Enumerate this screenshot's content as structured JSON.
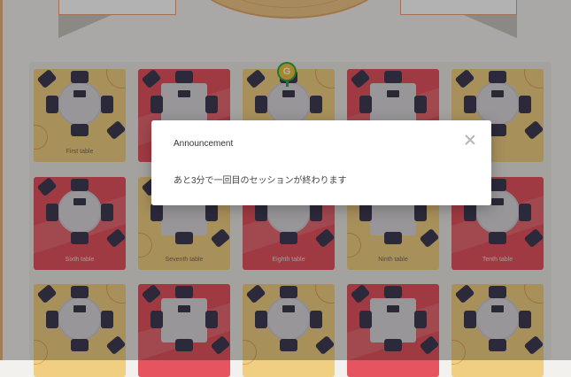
{
  "room": {
    "tables": [
      {
        "label": "First table",
        "style": "yellow",
        "desk": "round"
      },
      {
        "label": "",
        "style": "red",
        "desk": "square"
      },
      {
        "label": "",
        "style": "yellow",
        "desk": "round"
      },
      {
        "label": "",
        "style": "red",
        "desk": "square"
      },
      {
        "label": "",
        "style": "yellow",
        "desk": "round"
      },
      {
        "label": "Sixth table",
        "style": "red",
        "desk": "round"
      },
      {
        "label": "Seventh table",
        "style": "yellow",
        "desk": "square"
      },
      {
        "label": "Eighth table",
        "style": "red",
        "desk": "round"
      },
      {
        "label": "Ninth table",
        "style": "yellow",
        "desk": "square"
      },
      {
        "label": "Tenth table",
        "style": "red",
        "desk": "round"
      },
      {
        "label": "",
        "style": "yellow",
        "desk": "round"
      },
      {
        "label": "",
        "style": "red",
        "desk": "square"
      },
      {
        "label": "",
        "style": "yellow",
        "desk": "round"
      },
      {
        "label": "",
        "style": "red",
        "desk": "square"
      },
      {
        "label": "",
        "style": "yellow",
        "desk": "round"
      }
    ],
    "guest_marker": "G"
  },
  "dialog": {
    "title": "Announcement",
    "message": "あと3分で一回目のセッションが終わります",
    "close_icon": "close-icon"
  },
  "colors": {
    "table_yellow": "#f1cf82",
    "table_red": "#e5545f",
    "marker_ring": "#2eaa47",
    "marker_fill": "#f0c23e"
  }
}
